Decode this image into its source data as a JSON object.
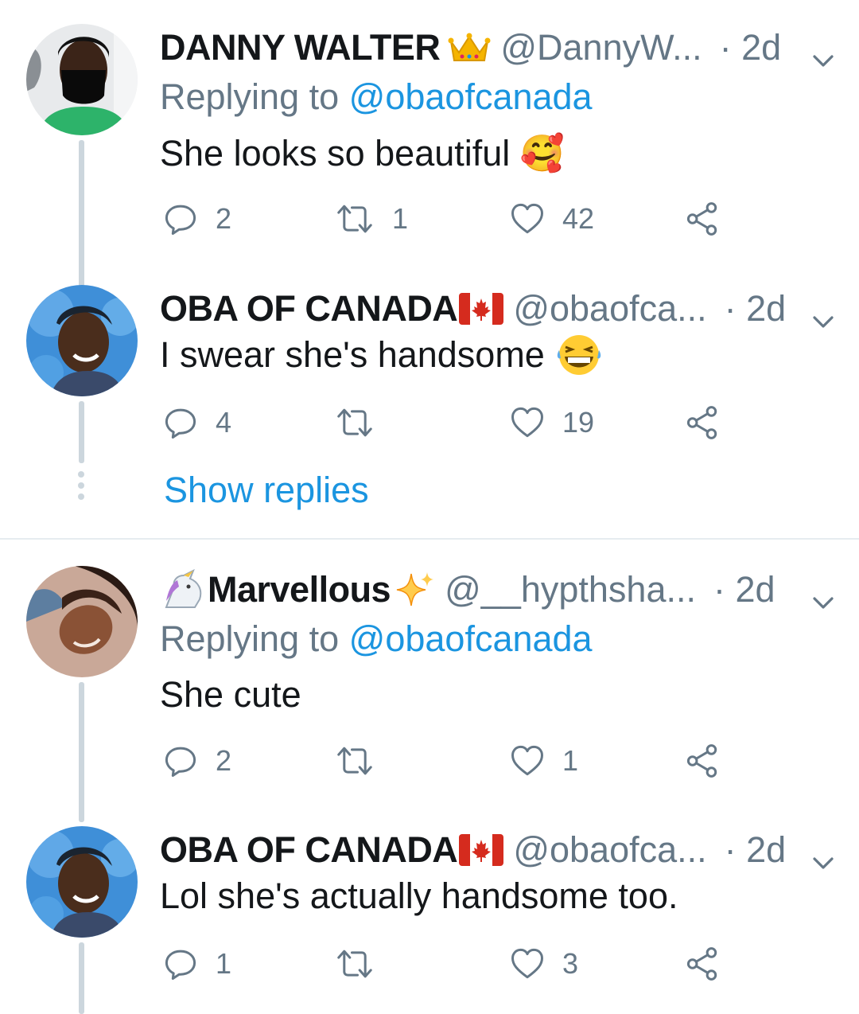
{
  "tweets": [
    {
      "name": "DANNY WALTER",
      "name_emoji": "crown-icon",
      "handle": "@DannyW...",
      "time": "· 2d",
      "reply_prefix": "Replying to",
      "reply_to": "@obaofcanada",
      "text": "She looks so beautiful 🥰",
      "replies": "2",
      "retweets": "1",
      "likes": "42"
    },
    {
      "name": "OBA OF CANADA",
      "name_emoji": "canada-flag-icon",
      "handle": "@obaofca...",
      "time": "· 2d",
      "text": "I swear she's handsome",
      "text_emoji": "laughing-emoji-icon",
      "replies": "4",
      "retweets": "",
      "likes": "19"
    },
    {
      "name": "Marvellous",
      "name_emoji_before": "unicorn-icon",
      "name_emoji": "sparkles-icon",
      "handle": "@__hypthsha...",
      "time": "· 2d",
      "reply_prefix": "Replying to",
      "reply_to": "@obaofcanada",
      "text": "She cute",
      "replies": "2",
      "retweets": "",
      "likes": "1"
    },
    {
      "name": "OBA OF CANADA",
      "name_emoji": "canada-flag-icon",
      "handle": "@obaofca...",
      "time": "· 2d",
      "text": "Lol she's actually handsome too.",
      "replies": "1",
      "retweets": "",
      "likes": "3"
    }
  ],
  "show_replies": "Show replies",
  "colors": {
    "link": "#1b95e0",
    "muted": "#657786",
    "thread": "#ccd6dd"
  }
}
